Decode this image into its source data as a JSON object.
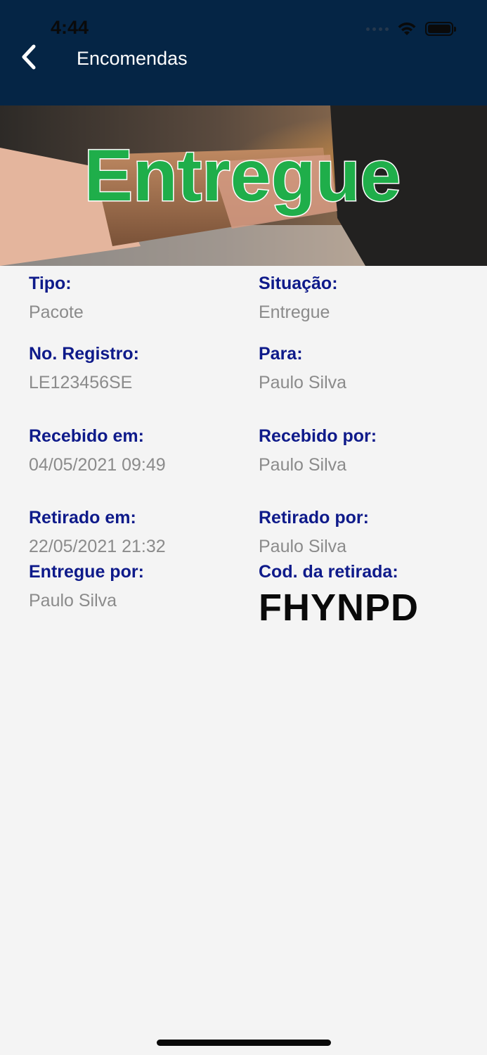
{
  "status_bar": {
    "time": "4:44"
  },
  "nav": {
    "title": "Encomendas"
  },
  "hero": {
    "banner_text": "Entregue"
  },
  "details": [
    {
      "label": "Tipo:",
      "value": "Pacote"
    },
    {
      "label": "Situação:",
      "value": "Entregue"
    },
    {
      "label": "No. Registro:",
      "value": "LE123456SE"
    },
    {
      "label": "Para:",
      "value": "Paulo Silva"
    },
    {
      "label": "Recebido em:",
      "value": "04/05/2021 09:49"
    },
    {
      "label": "Recebido por:",
      "value": "Paulo Silva"
    },
    {
      "label": "Retirado em:",
      "value": "22/05/2021 21:32"
    },
    {
      "label": "Retirado por:",
      "value": "Paulo Silva"
    },
    {
      "label": "Entregue por:",
      "value": "Paulo Silva"
    },
    {
      "label": "Cod. da retirada:",
      "value": "FHYNPD"
    }
  ],
  "colors": {
    "header": "#052545",
    "label": "#0e1a8a",
    "value": "#8b8b8b",
    "banner_text": "#1fae4a"
  }
}
